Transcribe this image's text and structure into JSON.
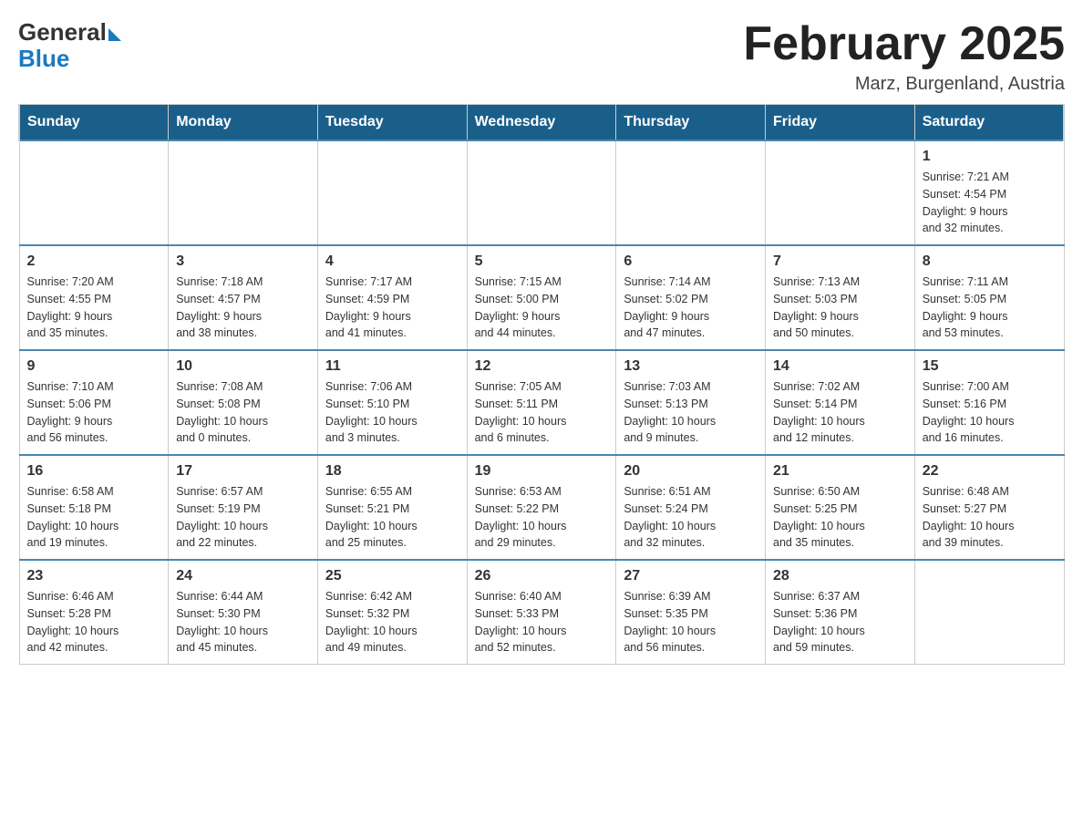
{
  "header": {
    "logo_general": "General",
    "logo_blue": "Blue",
    "month_title": "February 2025",
    "location": "Marz, Burgenland, Austria"
  },
  "weekdays": [
    "Sunday",
    "Monday",
    "Tuesday",
    "Wednesday",
    "Thursday",
    "Friday",
    "Saturday"
  ],
  "weeks": [
    [
      {
        "day": "",
        "info": ""
      },
      {
        "day": "",
        "info": ""
      },
      {
        "day": "",
        "info": ""
      },
      {
        "day": "",
        "info": ""
      },
      {
        "day": "",
        "info": ""
      },
      {
        "day": "",
        "info": ""
      },
      {
        "day": "1",
        "info": "Sunrise: 7:21 AM\nSunset: 4:54 PM\nDaylight: 9 hours\nand 32 minutes."
      }
    ],
    [
      {
        "day": "2",
        "info": "Sunrise: 7:20 AM\nSunset: 4:55 PM\nDaylight: 9 hours\nand 35 minutes."
      },
      {
        "day": "3",
        "info": "Sunrise: 7:18 AM\nSunset: 4:57 PM\nDaylight: 9 hours\nand 38 minutes."
      },
      {
        "day": "4",
        "info": "Sunrise: 7:17 AM\nSunset: 4:59 PM\nDaylight: 9 hours\nand 41 minutes."
      },
      {
        "day": "5",
        "info": "Sunrise: 7:15 AM\nSunset: 5:00 PM\nDaylight: 9 hours\nand 44 minutes."
      },
      {
        "day": "6",
        "info": "Sunrise: 7:14 AM\nSunset: 5:02 PM\nDaylight: 9 hours\nand 47 minutes."
      },
      {
        "day": "7",
        "info": "Sunrise: 7:13 AM\nSunset: 5:03 PM\nDaylight: 9 hours\nand 50 minutes."
      },
      {
        "day": "8",
        "info": "Sunrise: 7:11 AM\nSunset: 5:05 PM\nDaylight: 9 hours\nand 53 minutes."
      }
    ],
    [
      {
        "day": "9",
        "info": "Sunrise: 7:10 AM\nSunset: 5:06 PM\nDaylight: 9 hours\nand 56 minutes."
      },
      {
        "day": "10",
        "info": "Sunrise: 7:08 AM\nSunset: 5:08 PM\nDaylight: 10 hours\nand 0 minutes."
      },
      {
        "day": "11",
        "info": "Sunrise: 7:06 AM\nSunset: 5:10 PM\nDaylight: 10 hours\nand 3 minutes."
      },
      {
        "day": "12",
        "info": "Sunrise: 7:05 AM\nSunset: 5:11 PM\nDaylight: 10 hours\nand 6 minutes."
      },
      {
        "day": "13",
        "info": "Sunrise: 7:03 AM\nSunset: 5:13 PM\nDaylight: 10 hours\nand 9 minutes."
      },
      {
        "day": "14",
        "info": "Sunrise: 7:02 AM\nSunset: 5:14 PM\nDaylight: 10 hours\nand 12 minutes."
      },
      {
        "day": "15",
        "info": "Sunrise: 7:00 AM\nSunset: 5:16 PM\nDaylight: 10 hours\nand 16 minutes."
      }
    ],
    [
      {
        "day": "16",
        "info": "Sunrise: 6:58 AM\nSunset: 5:18 PM\nDaylight: 10 hours\nand 19 minutes."
      },
      {
        "day": "17",
        "info": "Sunrise: 6:57 AM\nSunset: 5:19 PM\nDaylight: 10 hours\nand 22 minutes."
      },
      {
        "day": "18",
        "info": "Sunrise: 6:55 AM\nSunset: 5:21 PM\nDaylight: 10 hours\nand 25 minutes."
      },
      {
        "day": "19",
        "info": "Sunrise: 6:53 AM\nSunset: 5:22 PM\nDaylight: 10 hours\nand 29 minutes."
      },
      {
        "day": "20",
        "info": "Sunrise: 6:51 AM\nSunset: 5:24 PM\nDaylight: 10 hours\nand 32 minutes."
      },
      {
        "day": "21",
        "info": "Sunrise: 6:50 AM\nSunset: 5:25 PM\nDaylight: 10 hours\nand 35 minutes."
      },
      {
        "day": "22",
        "info": "Sunrise: 6:48 AM\nSunset: 5:27 PM\nDaylight: 10 hours\nand 39 minutes."
      }
    ],
    [
      {
        "day": "23",
        "info": "Sunrise: 6:46 AM\nSunset: 5:28 PM\nDaylight: 10 hours\nand 42 minutes."
      },
      {
        "day": "24",
        "info": "Sunrise: 6:44 AM\nSunset: 5:30 PM\nDaylight: 10 hours\nand 45 minutes."
      },
      {
        "day": "25",
        "info": "Sunrise: 6:42 AM\nSunset: 5:32 PM\nDaylight: 10 hours\nand 49 minutes."
      },
      {
        "day": "26",
        "info": "Sunrise: 6:40 AM\nSunset: 5:33 PM\nDaylight: 10 hours\nand 52 minutes."
      },
      {
        "day": "27",
        "info": "Sunrise: 6:39 AM\nSunset: 5:35 PM\nDaylight: 10 hours\nand 56 minutes."
      },
      {
        "day": "28",
        "info": "Sunrise: 6:37 AM\nSunset: 5:36 PM\nDaylight: 10 hours\nand 59 minutes."
      },
      {
        "day": "",
        "info": ""
      }
    ]
  ]
}
